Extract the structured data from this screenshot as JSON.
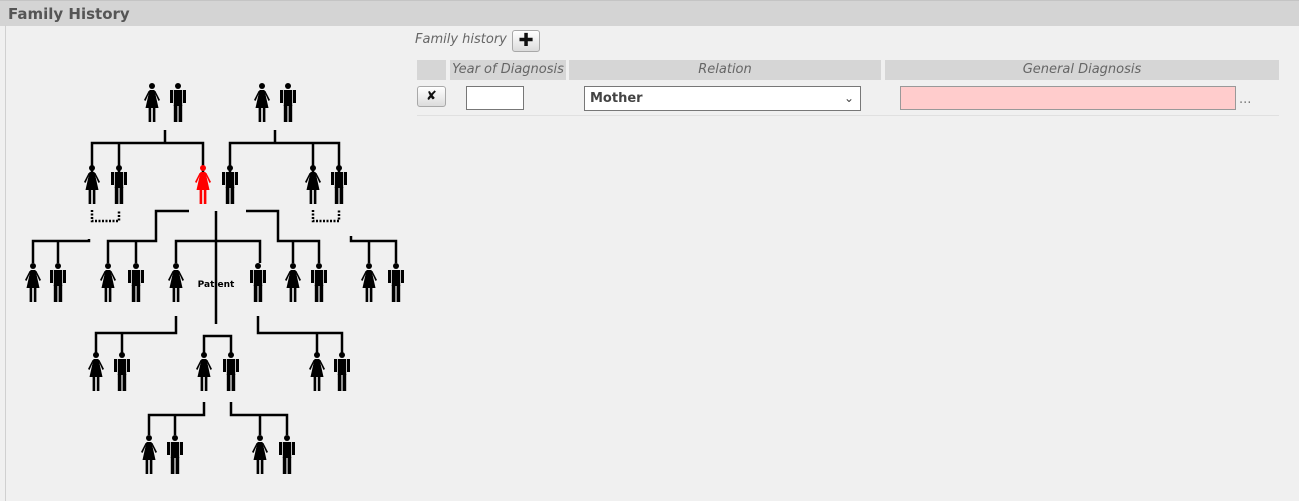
{
  "section": {
    "title": "Family History"
  },
  "pedigree": {
    "patient_label": "Patient",
    "highlight_color": "#ff0000",
    "figure_color": "#000000"
  },
  "family_history": {
    "label": "Family history",
    "add_button_icon": "plus-icon",
    "columns": [
      "",
      "Year of Diagnosis",
      "Relation",
      "General Diagnosis"
    ],
    "rows": [
      {
        "delete_icon": "x-icon",
        "year": "",
        "relation": "Mother",
        "general_diagnosis": "",
        "more": "...",
        "diagnosis_color": "#ffcccc"
      }
    ]
  }
}
